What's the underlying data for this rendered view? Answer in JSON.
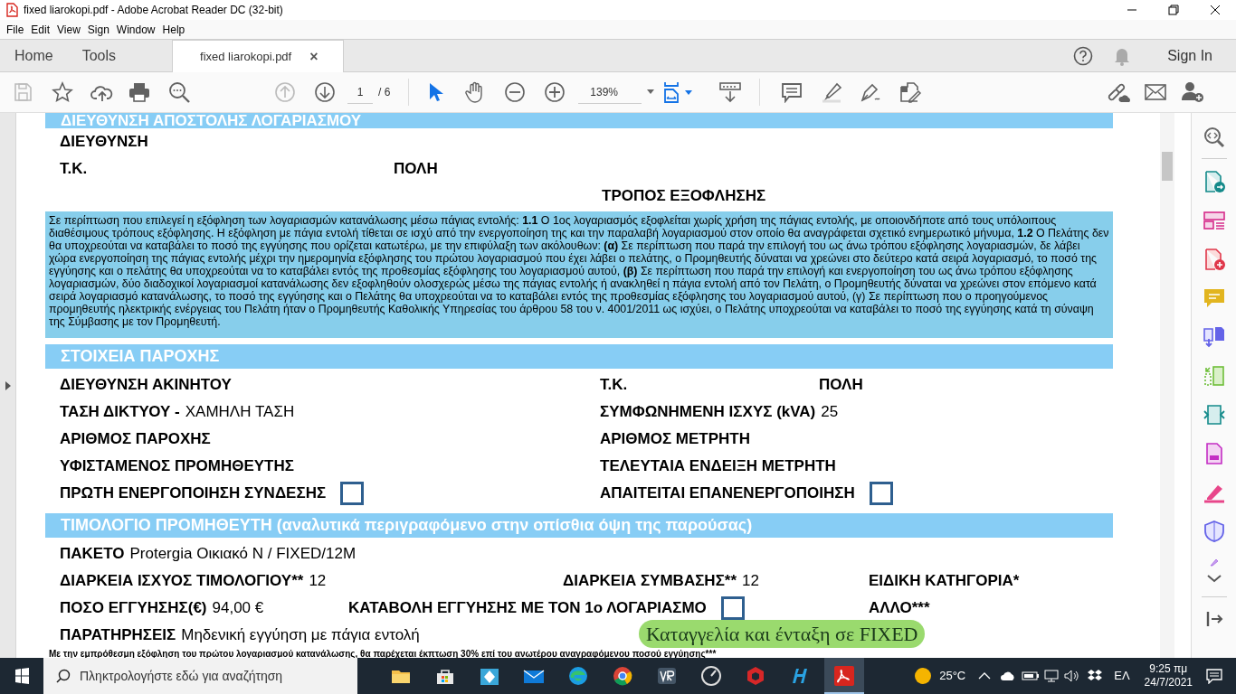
{
  "window": {
    "title": "fixed liarokopi.pdf - Adobe Acrobat Reader DC (32-bit)"
  },
  "menu": [
    "File",
    "Edit",
    "View",
    "Sign",
    "Window",
    "Help"
  ],
  "tabs": [
    {
      "label": "Home",
      "selected": false
    },
    {
      "label": "Tools",
      "selected": false
    },
    {
      "label": "fixed liarokopi.pdf",
      "selected": true,
      "close": "×"
    }
  ],
  "sign_in": "Sign In",
  "toolbar": {
    "page": "1",
    "page_total": "/ 6",
    "zoom": "139%"
  },
  "document": {
    "blocks": [
      {
        "kind": "header",
        "text": "ΔΙΕΥΘΥΝΣΗ ΑΠΟΣΤΟΛΗΣ ΛΟΓΑΡΙΑΣΜΟΥ"
      },
      {
        "kind": "row",
        "fields": [
          {
            "label": "ΔΙΕΥΘΥΝΣΗ"
          }
        ]
      },
      {
        "kind": "row",
        "fields": [
          {
            "label": "Τ.Κ."
          },
          {
            "label": "ΠΟΛΗ"
          }
        ]
      },
      {
        "kind": "row",
        "fields": [
          {
            "label": "ΤΡΟΠΟΣ ΕΞΟΦΛΗΣΗΣ"
          }
        ]
      },
      {
        "kind": "paragraph",
        "text": "Σε περίπτωση που επιλεγεί η εξόφληση των λογαριασμών κατανάλωσης μέσω πάγιας εντολής: **1.1** Ο 1ος λογαριασμός εξοφλείται χωρίς χρήση της πάγιας εντολής, με οποιονδήποτε από τους υπόλοιπους διαθέσιμους τρόπους εξόφλησης. Η εξόφληση με πάγια εντολή τίθεται σε ισχύ από την ενεργοποίηση της και την παραλαβή λογαριασμού στον οποίο θα αναγράφεται σχετικό ενημερωτικό μήνυμα, **1.2** Ο Πελάτης δεν θα υποχρεούται να καταβάλει το ποσό της εγγύησης που ορίζεται κατωτέρω, με την επιφύλαξη των ακόλουθων: **(α)** Σε περίπτωση που παρά την επιλογή του ως άνω τρόπου εξόφλησης λογαριασμών, δε λάβει χώρα ενεργοποίηση της πάγιας εντολής μέχρι την ημερομηνία εξόφλησης του πρώτου λογαριασμού που έχει λάβει ο πελάτης, ο Προμηθευτής δύναται να χρεώνει στο δεύτερο κατά σειρά λογαριασμό, το ποσό της εγγύησης και ο πελάτης θα υποχρεούται να το καταβάλει εντός της προθεσμίας εξόφλησης του λογαριασμού αυτού, **(β)** Σε περίπτωση που παρά την επιλογή και ενεργοποίηση του ως άνω τρόπου εξόφλησης λογαριασμών, δύο διαδοχικοί λογαριασμοί κατανάλωσης δεν εξοφληθούν ολοσχερώς μέσω της πάγιας εντολής ή ανακληθεί η πάγια εντολή από τον Πελάτη, ο Προμηθευτής δύναται να χρεώνει στον επόμενο κατά σειρά λογαριασμό κατανάλωσης, το ποσό της εγγύησης και ο Πελάτης θα υποχρεούται να το καταβάλει εντός της προθεσμίας εξόφλησης του λογαριασμού αυτού, (γ) Σε περίπτωση που ο προηγούμενος προμηθευτής ηλεκτρικής ενέργειας του Πελάτη ήταν ο Προμηθευτής Καθολικής Υπηρεσίας  του άρθρου 58 του ν. 4001/2011 ως ισχύει, ο Πελάτης υποχρεούται να καταβάλει το ποσό της εγγύησης κατά τη σύναψη της Σύμβασης με τον Προμηθευτή."
      },
      {
        "kind": "header",
        "text": "ΣΤΟΙΧΕΙΑ ΠΑΡΟΧΗΣ"
      },
      {
        "kind": "row",
        "fields": [
          {
            "label": "ΔΙΕΥΘΥΝΣΗ ΑΚΙΝΗΤΟΥ"
          },
          {
            "label": "Τ.Κ."
          },
          {
            "label": "ΠΟΛΗ"
          }
        ]
      },
      {
        "kind": "row",
        "fields": [
          {
            "label": "ΤΑΣΗ ΔΙΚΤΥΟΥ -",
            "value": "ΧΑΜΗΛΗ ΤΑΣΗ"
          },
          {
            "label": "ΣΥΜΦΩΝΗΜΕΝΗ ΙΣΧΥΣ (kVA)",
            "value": "25"
          }
        ]
      },
      {
        "kind": "row",
        "fields": [
          {
            "label": "ΑΡΙΘΜΟΣ ΠΑΡΟΧΗΣ"
          },
          {
            "label": "ΑΡΙΘΜΟΣ ΜΕΤΡΗΤΗ"
          }
        ]
      },
      {
        "kind": "row",
        "fields": [
          {
            "label": "ΥΦΙΣΤΑΜΕΝΟΣ ΠΡΟΜΗΘΕΥΤΗΣ"
          },
          {
            "label": "ΤΕΛΕΥΤΑΙΑ ΕΝΔΕΙΞΗ ΜΕΤΡΗΤΗ"
          }
        ]
      },
      {
        "kind": "row",
        "fields": [
          {
            "label": "ΠΡΩΤΗ ΕΝΕΡΓΟΠΟΙΗΣΗ ΣΥΝΔΕΣΗΣ",
            "checkbox": {
              "checked": false
            }
          },
          {
            "label": "ΑΠΑΙΤΕΙΤΑΙ ΕΠΑΝΕΝΕΡΓΟΠΟΙΗΣΗ",
            "checkbox": {
              "checked": false
            }
          }
        ]
      },
      {
        "kind": "header",
        "text": "ΤΙΜΟΛΟΓΙΟ ΠΡΟΜΗΘΕΥΤΗ (αναλυτικά περιγραφόμενο στην οπίσθια όψη της παρούσας)"
      },
      {
        "kind": "row",
        "fields": [
          {
            "label": "ΠΑΚΕΤΟ",
            "value": "Protergia Οικιακό Ν / FIXED/12M"
          }
        ]
      },
      {
        "kind": "row",
        "fields": [
          {
            "label": "ΔΙΑΡΚΕΙΑ ΙΣΧΥΟΣ ΤΙΜΟΛΟΓΙΟΥ**",
            "value": "12"
          },
          {
            "label": "ΔΙΑΡΚΕΙΑ ΣΥΜΒΑΣΗΣ**",
            "value": "12"
          },
          {
            "label": "ΕΙΔΙΚΗ ΚΑΤΗΓΟΡΙΑ*"
          }
        ]
      },
      {
        "kind": "row",
        "fields": [
          {
            "label": "ΠΟΣΟ ΕΓΓΥΗΣΗΣ(€)",
            "value": "94,00 €"
          },
          {
            "label": "ΚΑΤΑΒΟΛΗ ΕΓΓΥΗΣΗΣ ΜΕ ΤΟΝ 1ο ΛΟΓΑΡΙΑΣΜΟ",
            "checkbox": {
              "checked": false
            }
          },
          {
            "label": "ΑΛΛΟ***"
          }
        ]
      },
      {
        "kind": "row",
        "fields": [
          {
            "label": "ΠΑΡΑΤΗΡΗΣΕΙΣ",
            "value": "Μηδενική εγγύηση με πάγια εντολή"
          }
        ]
      },
      {
        "kind": "note",
        "text": "Με την εμπρόθεσμη εξόφληση του πρώτου λογαριασμού κατανάλωσης, θα παρέχεται έκπτωση 30% επί του ανωτέρου αναγραφόμενου ποσού εγγύησης***"
      }
    ]
  },
  "annotation": {
    "text": "Καταγγελία και ένταξη σε FIXED"
  },
  "taskbar": {
    "search_placeholder": "Πληκτρολογήστε εδώ για αναζήτηση",
    "apps": [
      {
        "kind": "folder",
        "selected": false
      },
      {
        "kind": "store",
        "selected": false
      },
      {
        "kind": "tiles",
        "selected": false
      },
      {
        "kind": "mail",
        "selected": false
      },
      {
        "kind": "edge",
        "selected": false
      },
      {
        "kind": "chrome",
        "selected": false
      },
      {
        "kind": "vr",
        "selected": false
      },
      {
        "kind": "gauge",
        "selected": false
      },
      {
        "kind": "cube",
        "selected": false
      },
      {
        "kind": "hlogo",
        "selected": false
      },
      {
        "kind": "acrobat",
        "selected": true
      }
    ],
    "temperature": "25°C",
    "language": "ΕΛ",
    "time": "9:25 πμ",
    "date": "24/7/2021"
  }
}
